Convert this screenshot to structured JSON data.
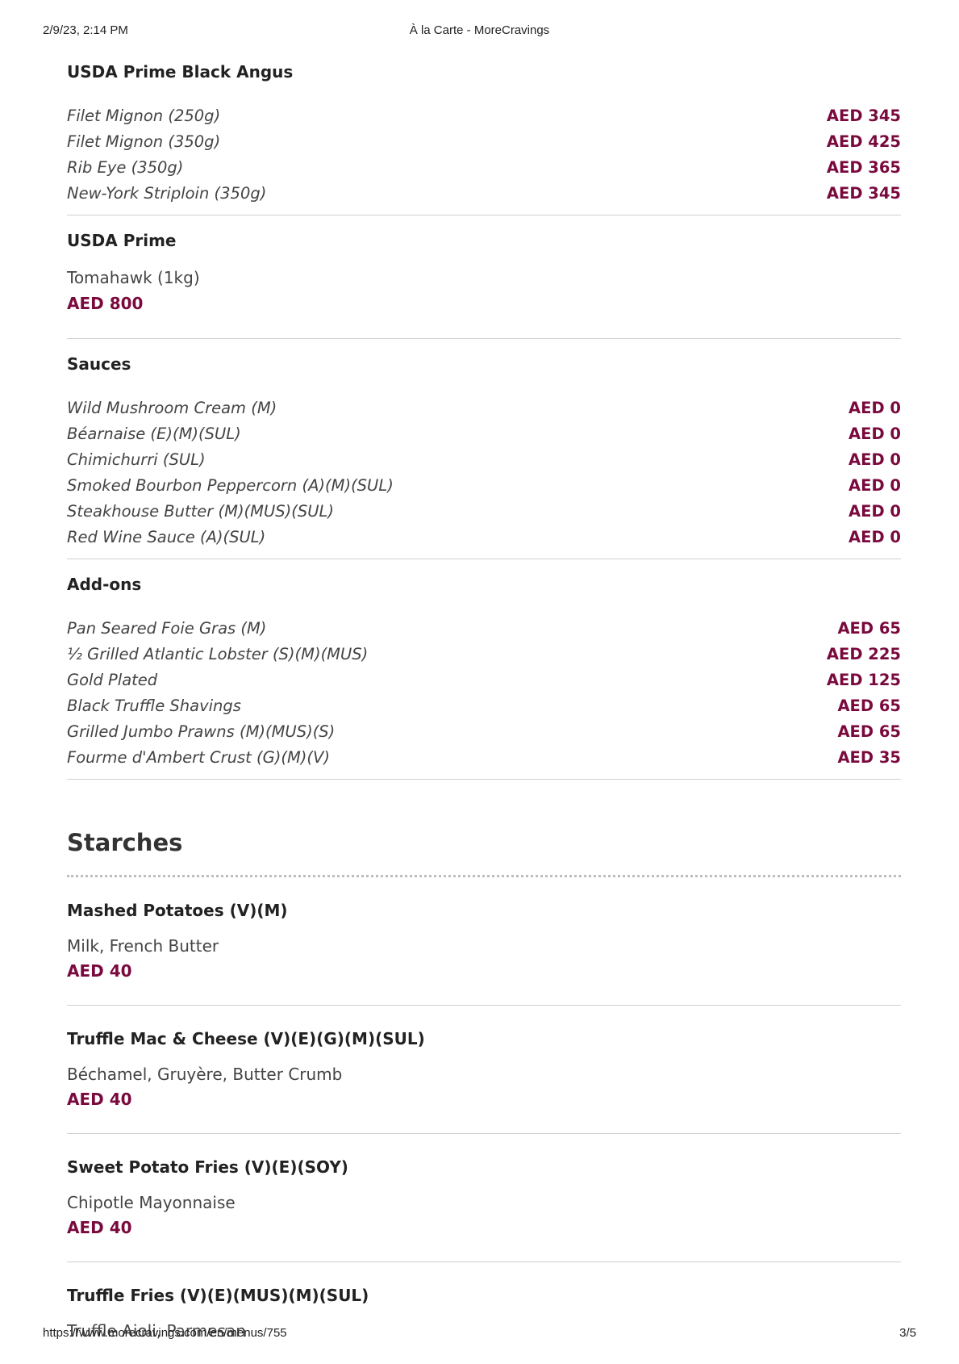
{
  "print_header": {
    "datetime": "2/9/23, 2:14 PM",
    "title": "À la Carte - MoreCravings"
  },
  "print_footer": {
    "url": "https://www.morecravings.com/en/menus/755",
    "page": "3/5"
  },
  "colors": {
    "price": "#7a0a3e",
    "text": "#333333",
    "divider": "#d0d0d0"
  },
  "sections": [
    {
      "title": "USDA Prime Black Angus",
      "items": [
        {
          "name": "Filet Mignon (250g)",
          "price": "AED 345"
        },
        {
          "name": "Filet Mignon (350g)",
          "price": "AED 425"
        },
        {
          "name": "Rib Eye (350g)",
          "price": "AED 365"
        },
        {
          "name": "New-York Striploin (350g)",
          "price": "AED 345"
        }
      ]
    },
    {
      "title": "USDA Prime",
      "description": "Tomahawk (1kg)",
      "price": "AED 800"
    },
    {
      "title": "Sauces",
      "items": [
        {
          "name": "Wild Mushroom Cream (M)",
          "price": "AED 0"
        },
        {
          "name": "Béarnaise (E)(M)(SUL)",
          "price": "AED 0"
        },
        {
          "name": "Chimichurri (SUL)",
          "price": "AED 0"
        },
        {
          "name": "Smoked Bourbon Peppercorn (A)(M)(SUL)",
          "price": "AED 0"
        },
        {
          "name": "Steakhouse Butter (M)(MUS)(SUL)",
          "price": "AED 0"
        },
        {
          "name": "Red Wine Sauce (A)(SUL)",
          "price": "AED 0"
        }
      ]
    },
    {
      "title": "Add-ons",
      "items": [
        {
          "name": "Pan Seared Foie Gras (M)",
          "price": "AED 65"
        },
        {
          "name": "½ Grilled Atlantic Lobster (S)(M)(MUS)",
          "price": "AED 225"
        },
        {
          "name": "Gold Plated",
          "price": "AED 125"
        },
        {
          "name": "Black Truffle Shavings",
          "price": "AED 65"
        },
        {
          "name": "Grilled Jumbo Prawns (M)(MUS)(S)",
          "price": "AED 65"
        },
        {
          "name": "Fourme d'Ambert Crust (G)(M)(V)",
          "price": "AED 35"
        }
      ]
    }
  ],
  "category": {
    "title": "Starches",
    "dishes": [
      {
        "name": "Mashed Potatoes (V)(M)",
        "description": "Milk, French Butter",
        "price": "AED 40"
      },
      {
        "name": "Truffle Mac & Cheese (V)(E)(G)(M)(SUL)",
        "description": "Béchamel, Gruyère, Butter Crumb",
        "price": "AED 40"
      },
      {
        "name": "Sweet Potato Fries (V)(E)(SOY)",
        "description": "Chipotle Mayonnaise",
        "price": "AED 40"
      },
      {
        "name": "Truffle Fries (V)(E)(MUS)(M)(SUL)",
        "description": "Truffle Aioli, Parmesan"
      }
    ]
  }
}
